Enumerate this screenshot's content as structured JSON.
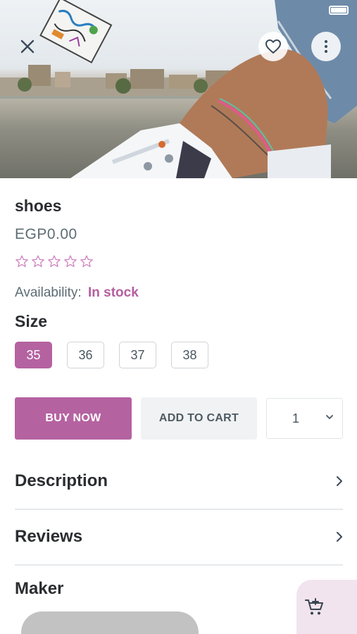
{
  "product": {
    "title": "shoes",
    "price": "EGP0.00",
    "rating_stars": 0,
    "rating_max": 5,
    "availability_label": "Availability:",
    "availability_value": "In stock"
  },
  "size": {
    "title": "Size",
    "options": [
      "35",
      "36",
      "37",
      "38"
    ],
    "selected": "35"
  },
  "actions": {
    "buy_now": "BUY NOW",
    "add_to_cart": "ADD TO CART",
    "quantity": "1"
  },
  "sections": {
    "description": "Description",
    "reviews": "Reviews",
    "maker": "Maker"
  },
  "colors": {
    "accent": "#b562a1",
    "fab_bg": "#f1e4ee"
  },
  "icons": {
    "close": "close-icon",
    "favorite": "heart-icon",
    "more": "more-vertical-icon",
    "chevron": "chevron-right-icon",
    "cart": "add-to-cart-icon",
    "star": "star-outline-icon"
  }
}
